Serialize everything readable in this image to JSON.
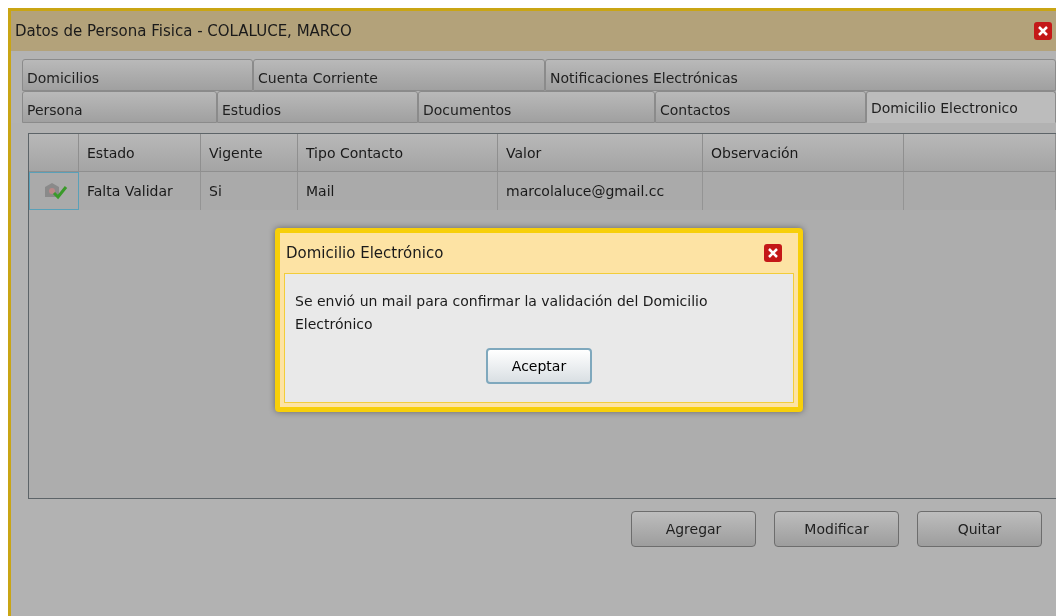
{
  "window": {
    "title": "Datos de Persona Fisica - COLALUCE, MARCO"
  },
  "tab_rows": [
    {
      "tabs": [
        {
          "label": "Domicilios",
          "selected": false
        },
        {
          "label": "Cuenta Corriente",
          "selected": false
        },
        {
          "label": "Notificaciones Electrónicas",
          "selected": false
        }
      ]
    },
    {
      "tabs": [
        {
          "label": "Persona",
          "selected": false
        },
        {
          "label": "Estudios",
          "selected": false
        },
        {
          "label": "Documentos",
          "selected": false
        },
        {
          "label": "Contactos",
          "selected": false
        },
        {
          "label": "Domicilio Electronico",
          "selected": true
        }
      ]
    }
  ],
  "table": {
    "columns": [
      "Estado",
      "Vigente",
      "Tipo Contacto",
      "Valor",
      "Observación"
    ],
    "rows": [
      {
        "cells": [
          "Falta Validar",
          "Si",
          "Mail",
          "marcolaluce@gmail.cc",
          ""
        ]
      }
    ]
  },
  "buttons": [
    "Agregar",
    "Modificar",
    "Quitar"
  ],
  "dialog": {
    "title": "Domicilio Electrónico",
    "message": "Se envió un mail para confirmar la validación del Domicilio Electrónico",
    "button": "Aceptar"
  }
}
